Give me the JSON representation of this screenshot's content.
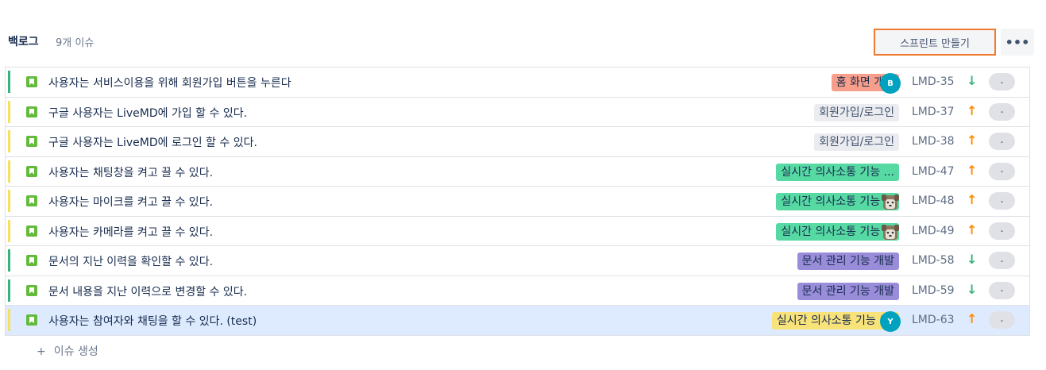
{
  "backlog": {
    "title": "백로그",
    "count": "9개 이슈",
    "sprint_button": "스프린트 만들기",
    "more_icon": "•••"
  },
  "issues": [
    {
      "summary": "사용자는 서비스이용을 위해 회원가입 버튼을 누른다",
      "epic": "홈 화면 개발",
      "epic_color": "#f79f8a",
      "epic_text_color": "#172b4d",
      "assignee": "B",
      "assignee_color": "#00a3bf",
      "key": "LMD-35",
      "priority": "↓",
      "priority_color": "#36b37e",
      "estimate": "-",
      "bar_color": "#36b37e"
    },
    {
      "summary": "구글 사용자는 LiveMD에 가입 할 수 있다.",
      "epic": "회원가입/로그인",
      "epic_color": "#ebecf0",
      "epic_text_color": "#42526e",
      "assignee": "",
      "assignee_color": "",
      "key": "LMD-37",
      "priority": "↑",
      "priority_color": "#ff8b00",
      "estimate": "-",
      "bar_color": "#f6e05e"
    },
    {
      "summary": "구글 사용자는 LiveMD에 로그인 할 수 있다.",
      "epic": "회원가입/로그인",
      "epic_color": "#ebecf0",
      "epic_text_color": "#42526e",
      "assignee": "",
      "assignee_color": "",
      "key": "LMD-38",
      "priority": "↑",
      "priority_color": "#ff8b00",
      "estimate": "-",
      "bar_color": "#f6e05e"
    },
    {
      "summary": "사용자는 채팅창을 켜고 끌 수 있다.",
      "epic": "실시간 의사소통 기능 ...",
      "epic_color": "#57d9a3",
      "epic_text_color": "#172b4d",
      "assignee": "",
      "assignee_color": "",
      "key": "LMD-47",
      "priority": "↑",
      "priority_color": "#ff8b00",
      "estimate": "-",
      "bar_color": "#f6e05e"
    },
    {
      "summary": "사용자는 마이크를 켜고 끌 수 있다.",
      "epic": "실시간 의사소통 기능 ...",
      "epic_color": "#57d9a3",
      "epic_text_color": "#172b4d",
      "assignee": "dog-avatar",
      "assignee_color": "",
      "key": "LMD-48",
      "priority": "↑",
      "priority_color": "#ff8b00",
      "estimate": "-",
      "bar_color": "#f6e05e"
    },
    {
      "summary": "사용자는 카메라를 켜고 끌 수 있다.",
      "epic": "실시간 의사소통 기능 ...",
      "epic_color": "#57d9a3",
      "epic_text_color": "#172b4d",
      "assignee": "dog-avatar",
      "assignee_color": "",
      "key": "LMD-49",
      "priority": "↑",
      "priority_color": "#ff8b00",
      "estimate": "-",
      "bar_color": "#f6e05e"
    },
    {
      "summary": "문서의 지난 이력을 확인할 수 있다.",
      "epic": "문서 관리 기능 개발",
      "epic_color": "#998dd9",
      "epic_text_color": "#172b4d",
      "assignee": "",
      "assignee_color": "",
      "key": "LMD-58",
      "priority": "↓",
      "priority_color": "#36b37e",
      "estimate": "-",
      "bar_color": "#36b37e"
    },
    {
      "summary": "문서 내용을 지난 이력으로 변경할 수 있다.",
      "epic": "문서 관리 기능 개발",
      "epic_color": "#998dd9",
      "epic_text_color": "#172b4d",
      "assignee": "",
      "assignee_color": "",
      "key": "LMD-59",
      "priority": "↓",
      "priority_color": "#36b37e",
      "estimate": "-",
      "bar_color": "#36b37e"
    },
    {
      "summary": "사용자는 참여자와 채팅을 할 수 있다. (test)",
      "epic": "실시간 의사소통 기능 (...",
      "epic_color": "#f8e27a",
      "epic_text_color": "#172b4d",
      "assignee": "Y",
      "assignee_color": "#00a3bf",
      "key": "LMD-63",
      "priority": "↑",
      "priority_color": "#ff8b00",
      "estimate": "-",
      "bar_color": "#f6e05e",
      "selected": true
    }
  ],
  "create_issue": {
    "plus": "+",
    "label": "이슈 생성"
  }
}
